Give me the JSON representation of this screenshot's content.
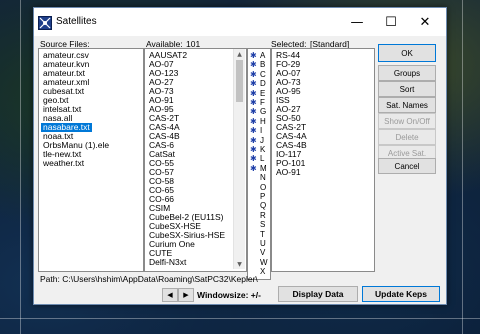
{
  "window": {
    "title": "Satellites",
    "minimize_glyph": "—",
    "maximize_glyph": "☐",
    "close_glyph": "✕"
  },
  "source_files": {
    "label": "Source Files:",
    "items": [
      "amateur.csv",
      "amateur.kvn",
      "amateur.txt",
      "amateur.xml",
      "cubesat.txt",
      "geo.txt",
      "intelsat.txt",
      "nasa.all",
      "nasabare.txt",
      "noaa.txt",
      "OrbsManu (1).ele",
      "tle-new.txt",
      "weather.txt"
    ],
    "selected": "nasabare.txt"
  },
  "available": {
    "label": "Available:",
    "count": "101",
    "items": [
      "AAUSAT2",
      "AO-07",
      "AO-123",
      "AO-27",
      "AO-73",
      "AO-91",
      "AO-95",
      "CAS-2T",
      "CAS-4A",
      "CAS-4B",
      "CAS-6",
      "CatSat",
      "CO-55",
      "CO-57",
      "CO-58",
      "CO-65",
      "CO-66",
      "CSIM",
      "CubeBel-2 (EU11S)",
      "CubeSX-HSE",
      "CubeSX-Sirius-HSE",
      "Curium One",
      "CUTE",
      "Delfi-N3xt"
    ]
  },
  "alphabet": {
    "letters": [
      "A",
      "B",
      "C",
      "D",
      "E",
      "F",
      "G",
      "H",
      "I",
      "J",
      "K",
      "L",
      "M",
      "N",
      "O",
      "P",
      "Q",
      "R",
      "S",
      "T",
      "U",
      "V",
      "W",
      "X"
    ],
    "star_glyph": "✱"
  },
  "selected_list": {
    "label": "Selected:",
    "group": "[Standard]",
    "items": [
      "RS-44",
      "FO-29",
      "AO-07",
      "AO-73",
      "AO-95",
      "ISS",
      "AO-27",
      "SO-50",
      "CAS-2T",
      "CAS-4A",
      "CAS-4B",
      "IO-117",
      "PO-101",
      "AO-91"
    ]
  },
  "buttons": {
    "ok": "OK",
    "groups": "Groups",
    "sort": "Sort",
    "sat_names": "Sat. Names",
    "show_on_off": "Show On/Off",
    "delete": "Delete",
    "active_sat": "Active Sat.",
    "cancel": "Cancel"
  },
  "footer": {
    "path": "Path: C:\\Users\\hshim\\AppData\\Roaming\\SatPC32\\Kepler\\",
    "prev_glyph": "◀",
    "next_glyph": "▶",
    "windowsize_label": "Windowsize: +/-",
    "display_data": "Display Data",
    "update_keps": "Update Keps"
  }
}
